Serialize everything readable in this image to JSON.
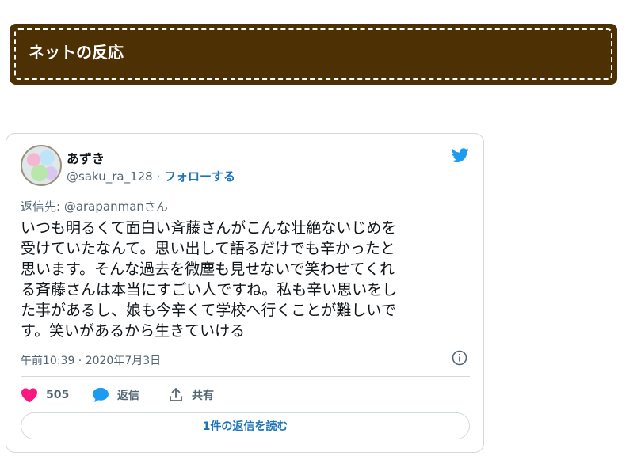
{
  "banner": {
    "title": "ネットの反応"
  },
  "tweet": {
    "author_name": "あずき",
    "handle": "@saku_ra_128",
    "separator": " · ",
    "follow_label": "フォローする",
    "reply_to": "返信先: @arapanmanさん",
    "body_lines": [
      "いつも明るくて面白い斉藤さんがこんな壮絶ないじめを",
      "受けていたなんて。思い出して語るだけでも辛かったと",
      "思います。そんな過去を微塵も見せないで笑わせてくれ",
      "る斉藤さんは本当にすごい人ですね。私も辛い思いをし",
      "た事があるし、娘も今辛くて学校へ行くことが難しいで",
      "す。笑いがあるから生きていける"
    ],
    "timestamp": "午前10:39 · 2020年7月3日",
    "like_count": "505",
    "reply_label": "返信",
    "share_label": "共有",
    "read_replies_label": "1件の返信を読む"
  },
  "colors": {
    "banner_bg": "#4d3004",
    "twitter_blue": "#1d9bf0",
    "link_blue": "#1d72b8",
    "like_pink": "#f91880",
    "muted_text": "#536471"
  },
  "icons": {
    "brand": "twitter-bird-icon",
    "info": "info-icon",
    "like": "heart-icon",
    "reply": "speech-bubble-icon",
    "share": "share-icon"
  }
}
